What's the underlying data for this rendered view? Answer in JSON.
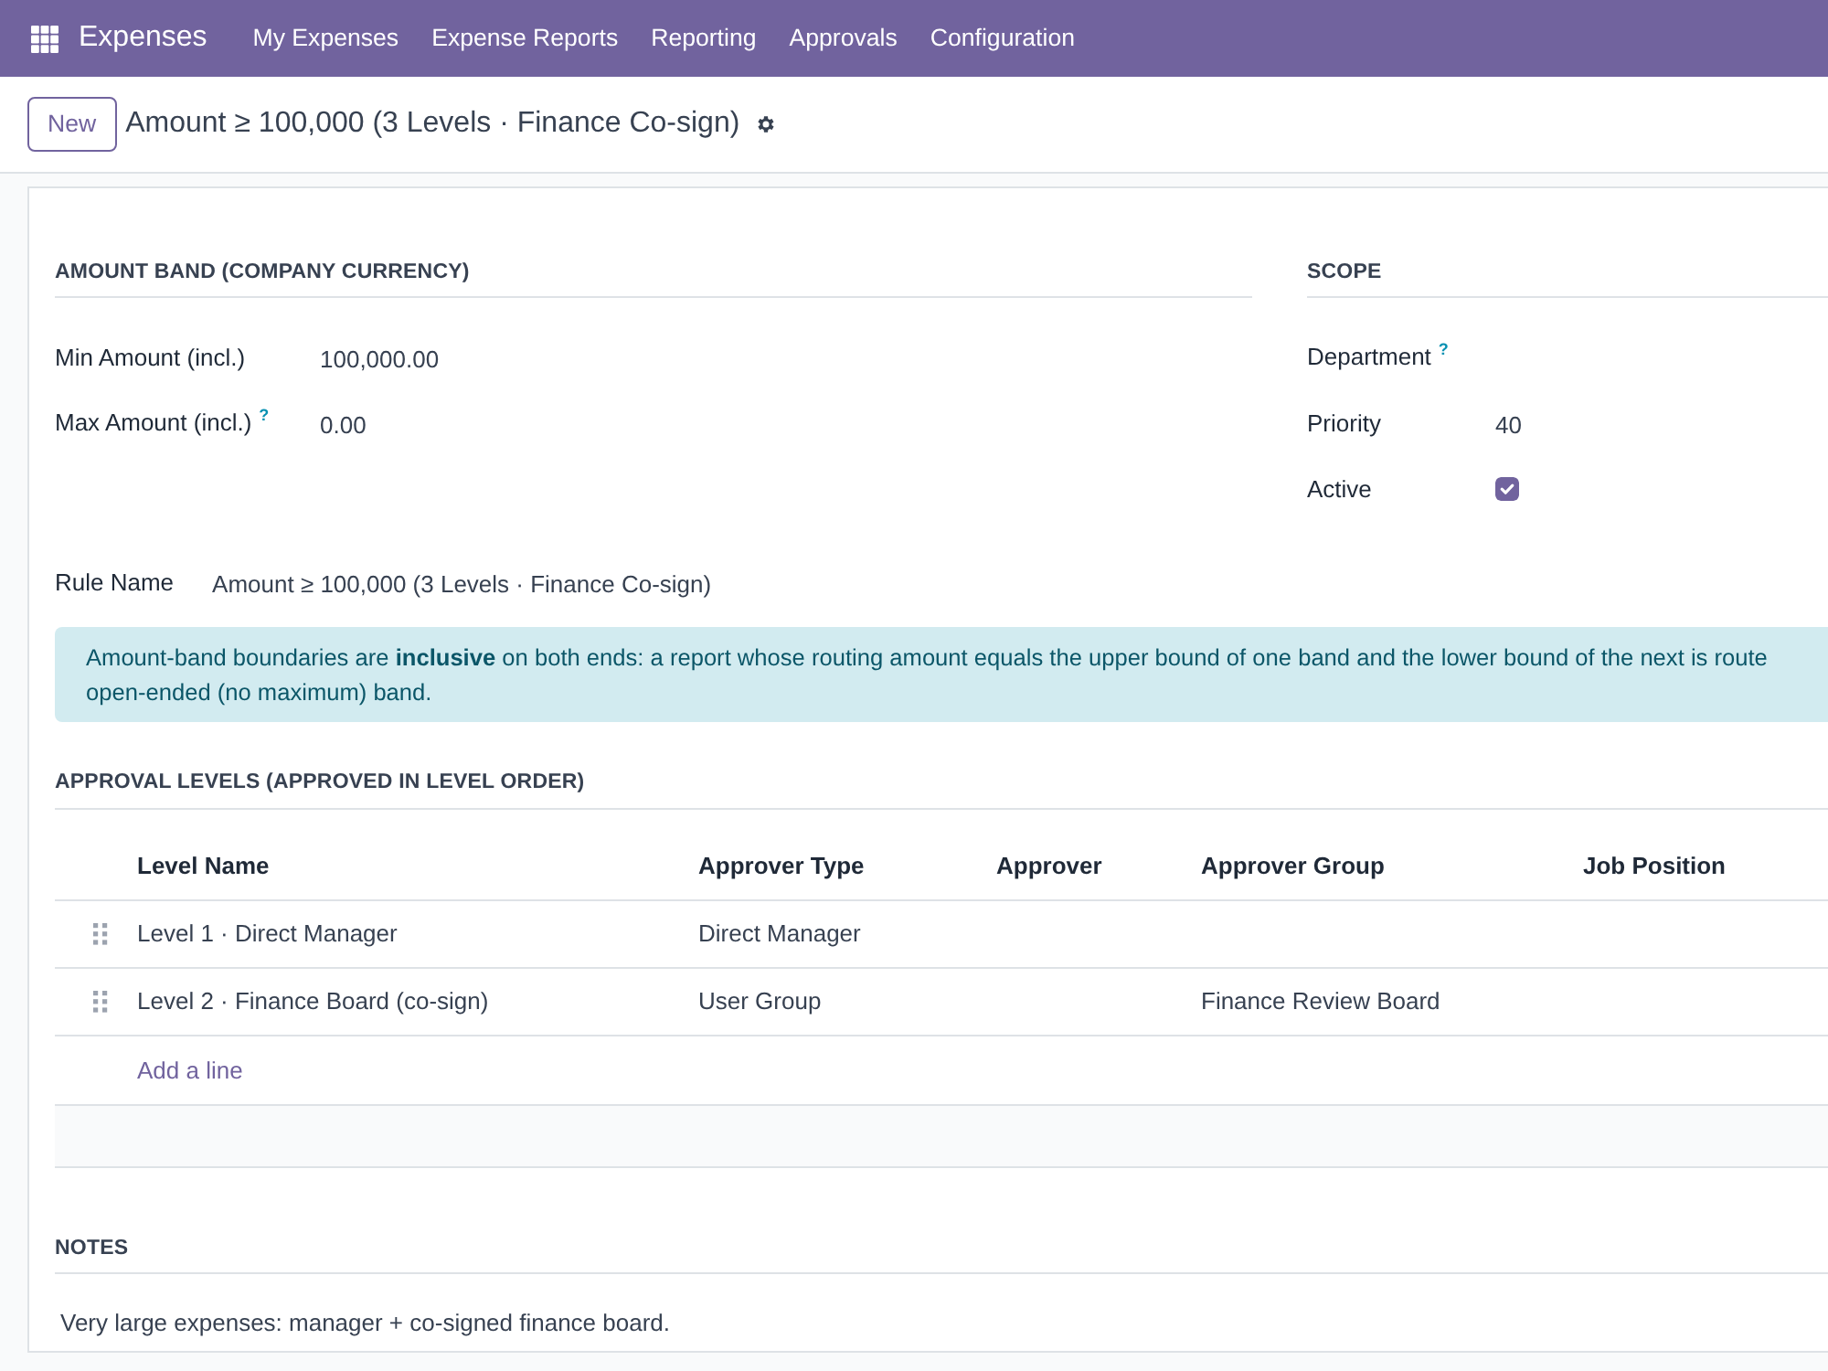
{
  "navbar": {
    "app_name": "Expenses",
    "menu": [
      "My Expenses",
      "Expense Reports",
      "Reporting",
      "Approvals",
      "Configuration"
    ]
  },
  "control_panel": {
    "new_button": "New",
    "record_title": "Amount ≥ 100,000 (3 Levels · Finance Co-sign)"
  },
  "groups": [
    {
      "title": "AMOUNT BAND (COMPANY CURRENCY)",
      "fields": [
        {
          "kind": "text",
          "label": "Min Amount (incl.)",
          "value": "100,000.00"
        },
        {
          "kind": "text",
          "label": "Max Amount (incl.)",
          "help": "?",
          "value": "0.00"
        }
      ]
    },
    {
      "title": "SCOPE",
      "fields": [
        {
          "kind": "text",
          "label": "Department",
          "help": "?"
        },
        {
          "kind": "text",
          "label": "Priority",
          "value": "40"
        },
        {
          "kind": "checkbox",
          "label": "Active",
          "checked": true
        }
      ]
    }
  ],
  "rule_name": {
    "label": "Rule Name",
    "value": "Amount ≥ 100,000 (3 Levels · Finance Co-sign)"
  },
  "alert": {
    "lines": [
      "Amount-band boundaries are **inclusive** on both ends: a report whose routing amount equals the upper bound of one band and the lower bound of the next is route",
      "open-ended (no maximum) band."
    ]
  },
  "approval_levels": {
    "title": "APPROVAL LEVELS (APPROVED IN LEVEL ORDER)",
    "columns": [
      "Level Name",
      "Approver Type",
      "Approver",
      "Approver Group",
      "Job Position"
    ],
    "rows": [
      {
        "level_name": "Level 1 · Direct Manager",
        "approver_type": "Direct Manager"
      },
      {
        "level_name": "Level 2 · Finance Board (co-sign)",
        "approver_type": "User Group",
        "approver_group": "Finance Review Board"
      }
    ],
    "add_line": "Add a line"
  },
  "notes": {
    "title": "NOTES",
    "text": "Very large expenses: manager + co-signed finance board."
  }
}
